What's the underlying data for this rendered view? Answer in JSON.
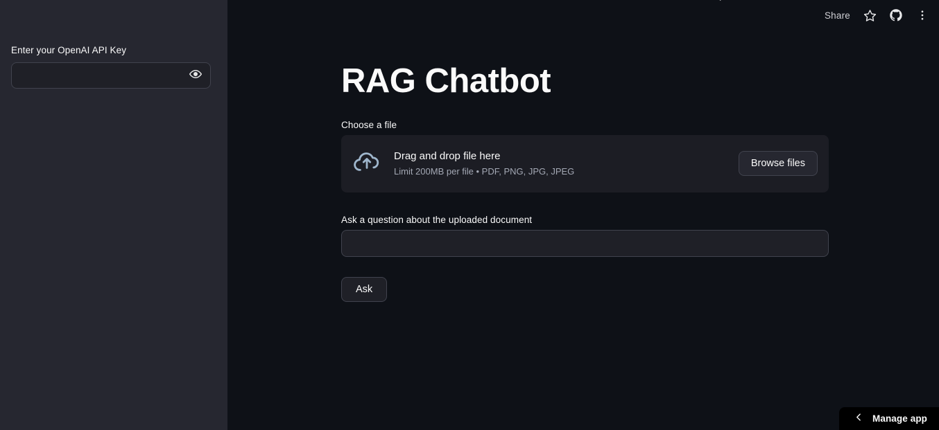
{
  "app": {
    "title": "RAG Chatbot",
    "theme_background": "#0e1117",
    "sidebar_background": "#262730",
    "accent_color": "#ff4b4b"
  },
  "sidebar": {
    "api_key_label": "Enter your OpenAI API Key",
    "api_key_value": "",
    "api_key_placeholder": "",
    "reveal_icon": "eye-icon"
  },
  "toolbar": {
    "share_label": "Share",
    "star_icon": "star-icon",
    "github_icon": "github-icon",
    "menu_icon": "kebab-menu-icon",
    "running_icon": "running-status-icon"
  },
  "main": {
    "file_uploader": {
      "label": "Choose a file",
      "drop_text": "Drag and drop file here",
      "limit_text": "Limit 200MB per file • PDF, PNG, JPG, JPEG",
      "browse_label": "Browse files",
      "upload_icon": "cloud-upload-icon"
    },
    "question": {
      "label": "Ask a question about the uploaded document",
      "value": "",
      "placeholder": ""
    },
    "ask_button_label": "Ask"
  },
  "footer": {
    "manage_app_label": "Manage app",
    "chevron_icon": "chevron-left-icon"
  }
}
